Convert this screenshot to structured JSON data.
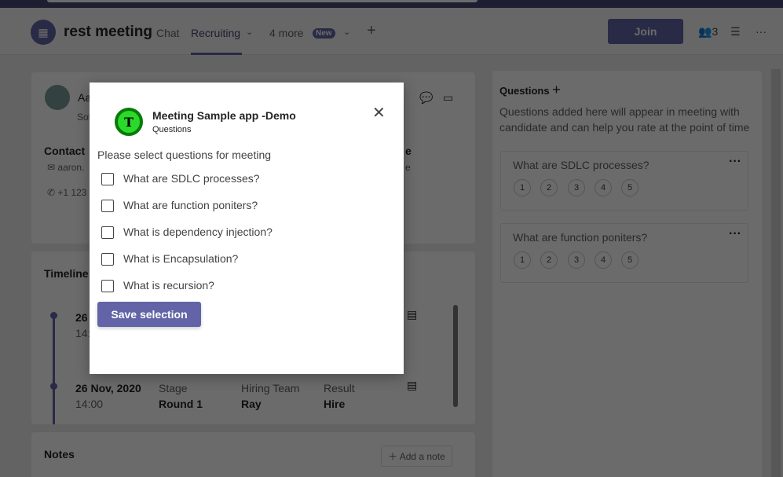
{
  "header": {
    "title": "rest meeting",
    "tabs": [
      {
        "label": "Chat"
      },
      {
        "label": "Recruiting"
      },
      {
        "label": "4 more"
      }
    ],
    "new_badge": "New",
    "join_label": "Join",
    "participants_count": "3"
  },
  "candidate": {
    "name_partial": "Aa",
    "role_partial": "Sof",
    "contact_label": "Contact",
    "email_partial": "aaron.",
    "phone_partial": "+1 123",
    "right_label_partial": "e",
    "right_value_partial": "e"
  },
  "timeline": {
    "title": "Timeline",
    "entries": [
      {
        "date": "26",
        "time": "14:"
      },
      {
        "date": "26 Nov, 2020",
        "time": "14:00",
        "stage_label": "Stage",
        "stage": "Round 1",
        "team_label": "Hiring Team",
        "team": "Ray",
        "result_label": "Result",
        "result": "Hire"
      }
    ]
  },
  "notes": {
    "title": "Notes",
    "add_label": "Add a note"
  },
  "questions_panel": {
    "title": "Questions",
    "description": "Questions added here will appear in meeting with candidate and can help you rate at the point of time",
    "items": [
      {
        "text": "What are SDLC processes?"
      },
      {
        "text": "What are function poniters?"
      }
    ],
    "ratings": [
      "1",
      "2",
      "3",
      "4",
      "5"
    ]
  },
  "dialog": {
    "app_title": "Meeting Sample app -Demo",
    "subtitle": "Questions",
    "logo_letter": "T",
    "prompt": "Please select questions for meeting",
    "options": [
      {
        "label": "What are SDLC processes?",
        "checked": false
      },
      {
        "label": "What are function poniters?",
        "checked": false
      },
      {
        "label": "What is dependency injection?",
        "checked": false
      },
      {
        "label": "What is Encapsulation?",
        "checked": false
      },
      {
        "label": "What is recursion?",
        "checked": false
      }
    ],
    "save_label": "Save selection"
  },
  "colors": {
    "brand": "#6264a7",
    "logo_green": "#2bd92b"
  }
}
